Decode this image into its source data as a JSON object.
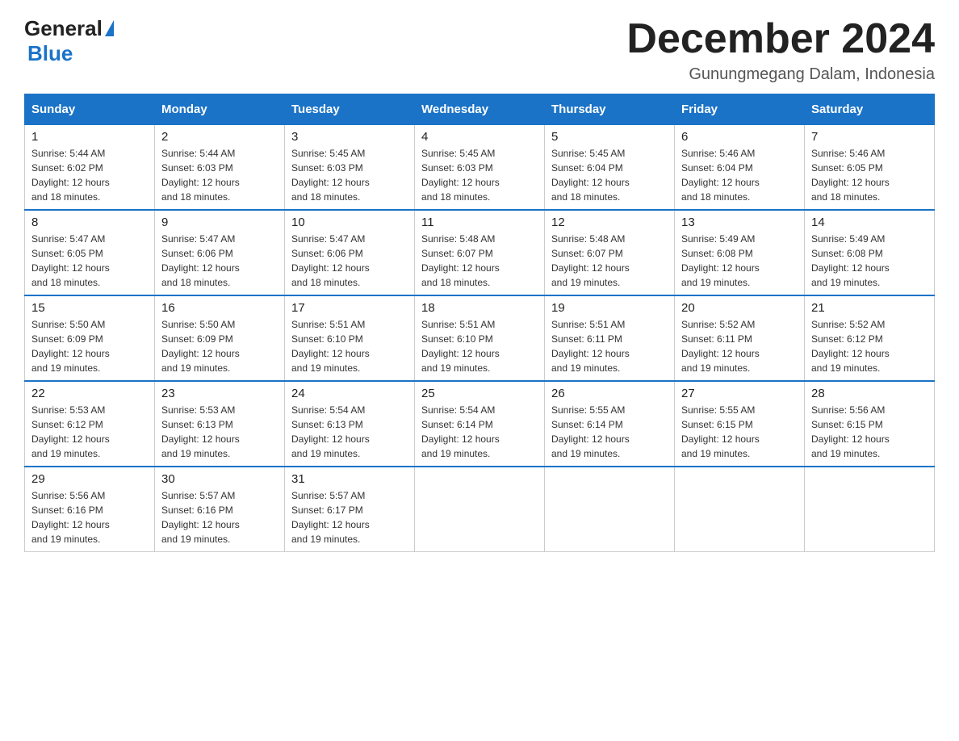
{
  "logo": {
    "general": "General",
    "triangle_char": "▶",
    "blue": "Blue"
  },
  "title": "December 2024",
  "subtitle": "Gunungmegang Dalam, Indonesia",
  "headers": [
    "Sunday",
    "Monday",
    "Tuesday",
    "Wednesday",
    "Thursday",
    "Friday",
    "Saturday"
  ],
  "weeks": [
    [
      {
        "day": "1",
        "sunrise": "5:44 AM",
        "sunset": "6:02 PM",
        "daylight": "12 hours and 18 minutes."
      },
      {
        "day": "2",
        "sunrise": "5:44 AM",
        "sunset": "6:03 PM",
        "daylight": "12 hours and 18 minutes."
      },
      {
        "day": "3",
        "sunrise": "5:45 AM",
        "sunset": "6:03 PM",
        "daylight": "12 hours and 18 minutes."
      },
      {
        "day": "4",
        "sunrise": "5:45 AM",
        "sunset": "6:03 PM",
        "daylight": "12 hours and 18 minutes."
      },
      {
        "day": "5",
        "sunrise": "5:45 AM",
        "sunset": "6:04 PM",
        "daylight": "12 hours and 18 minutes."
      },
      {
        "day": "6",
        "sunrise": "5:46 AM",
        "sunset": "6:04 PM",
        "daylight": "12 hours and 18 minutes."
      },
      {
        "day": "7",
        "sunrise": "5:46 AM",
        "sunset": "6:05 PM",
        "daylight": "12 hours and 18 minutes."
      }
    ],
    [
      {
        "day": "8",
        "sunrise": "5:47 AM",
        "sunset": "6:05 PM",
        "daylight": "12 hours and 18 minutes."
      },
      {
        "day": "9",
        "sunrise": "5:47 AM",
        "sunset": "6:06 PM",
        "daylight": "12 hours and 18 minutes."
      },
      {
        "day": "10",
        "sunrise": "5:47 AM",
        "sunset": "6:06 PM",
        "daylight": "12 hours and 18 minutes."
      },
      {
        "day": "11",
        "sunrise": "5:48 AM",
        "sunset": "6:07 PM",
        "daylight": "12 hours and 18 minutes."
      },
      {
        "day": "12",
        "sunrise": "5:48 AM",
        "sunset": "6:07 PM",
        "daylight": "12 hours and 19 minutes."
      },
      {
        "day": "13",
        "sunrise": "5:49 AM",
        "sunset": "6:08 PM",
        "daylight": "12 hours and 19 minutes."
      },
      {
        "day": "14",
        "sunrise": "5:49 AM",
        "sunset": "6:08 PM",
        "daylight": "12 hours and 19 minutes."
      }
    ],
    [
      {
        "day": "15",
        "sunrise": "5:50 AM",
        "sunset": "6:09 PM",
        "daylight": "12 hours and 19 minutes."
      },
      {
        "day": "16",
        "sunrise": "5:50 AM",
        "sunset": "6:09 PM",
        "daylight": "12 hours and 19 minutes."
      },
      {
        "day": "17",
        "sunrise": "5:51 AM",
        "sunset": "6:10 PM",
        "daylight": "12 hours and 19 minutes."
      },
      {
        "day": "18",
        "sunrise": "5:51 AM",
        "sunset": "6:10 PM",
        "daylight": "12 hours and 19 minutes."
      },
      {
        "day": "19",
        "sunrise": "5:51 AM",
        "sunset": "6:11 PM",
        "daylight": "12 hours and 19 minutes."
      },
      {
        "day": "20",
        "sunrise": "5:52 AM",
        "sunset": "6:11 PM",
        "daylight": "12 hours and 19 minutes."
      },
      {
        "day": "21",
        "sunrise": "5:52 AM",
        "sunset": "6:12 PM",
        "daylight": "12 hours and 19 minutes."
      }
    ],
    [
      {
        "day": "22",
        "sunrise": "5:53 AM",
        "sunset": "6:12 PM",
        "daylight": "12 hours and 19 minutes."
      },
      {
        "day": "23",
        "sunrise": "5:53 AM",
        "sunset": "6:13 PM",
        "daylight": "12 hours and 19 minutes."
      },
      {
        "day": "24",
        "sunrise": "5:54 AM",
        "sunset": "6:13 PM",
        "daylight": "12 hours and 19 minutes."
      },
      {
        "day": "25",
        "sunrise": "5:54 AM",
        "sunset": "6:14 PM",
        "daylight": "12 hours and 19 minutes."
      },
      {
        "day": "26",
        "sunrise": "5:55 AM",
        "sunset": "6:14 PM",
        "daylight": "12 hours and 19 minutes."
      },
      {
        "day": "27",
        "sunrise": "5:55 AM",
        "sunset": "6:15 PM",
        "daylight": "12 hours and 19 minutes."
      },
      {
        "day": "28",
        "sunrise": "5:56 AM",
        "sunset": "6:15 PM",
        "daylight": "12 hours and 19 minutes."
      }
    ],
    [
      {
        "day": "29",
        "sunrise": "5:56 AM",
        "sunset": "6:16 PM",
        "daylight": "12 hours and 19 minutes."
      },
      {
        "day": "30",
        "sunrise": "5:57 AM",
        "sunset": "6:16 PM",
        "daylight": "12 hours and 19 minutes."
      },
      {
        "day": "31",
        "sunrise": "5:57 AM",
        "sunset": "6:17 PM",
        "daylight": "12 hours and 19 minutes."
      },
      null,
      null,
      null,
      null
    ]
  ],
  "labels": {
    "sunrise": "Sunrise:",
    "sunset": "Sunset:",
    "daylight": "Daylight:"
  }
}
